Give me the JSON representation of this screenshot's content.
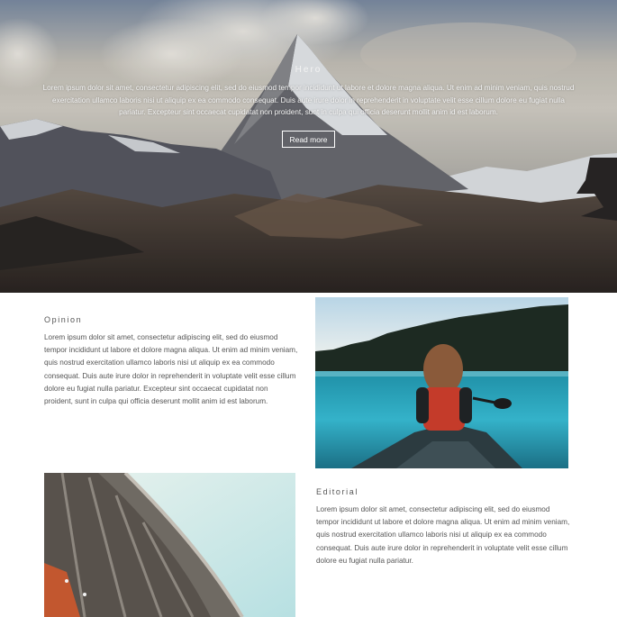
{
  "hero": {
    "title": "Hero",
    "text": "Lorem ipsum dolor sit amet, consectetur adipiscing elit, sed do eiusmod tempor incididunt ut labore et dolore magna aliqua. Ut enim ad minim veniam, quis nostrud exercitation ullamco laboris nisi ut aliquip ex ea commodo consequat. Duis aute irure dolor in reprehenderit in voluptate velit esse cillum dolore eu fugiat nulla pariatur. Excepteur sint occaecat cupidatat non proident, sunt in culpa qui officia deserunt mollit anim id est laborum.",
    "button_label": "Read more"
  },
  "opinion": {
    "title": "Opinion",
    "text": "Lorem ipsum dolor sit amet, consectetur adipiscing elit, sed do eiusmod tempor incididunt ut labore et dolore magna aliqua. Ut enim ad minim veniam, quis nostrud exercitation ullamco laboris nisi ut aliquip ex ea commodo consequat. Duis aute irure dolor in reprehenderit in voluptate velit esse cillum dolore eu fugiat nulla pariatur. Excepteur sint occaecat cupidatat non proident, sunt in culpa qui officia deserunt mollit anim id est laborum."
  },
  "editorial": {
    "title": "Editorial",
    "text": "Lorem ipsum dolor sit amet, consectetur adipiscing elit, sed do eiusmod tempor incididunt ut labore et dolore magna aliqua. Ut enim ad minim veniam, quis nostrud exercitation ullamco laboris nisi ut aliquip ex ea commodo consequat. Duis aute irure dolor in reprehenderit in voluptate velit esse cillum dolore eu fugiat nulla pariatur."
  },
  "images": {
    "hero": "mountain-landscape",
    "kayak": "person-in-canoe-on-lake",
    "bridge": "curved-bridge-underside"
  }
}
